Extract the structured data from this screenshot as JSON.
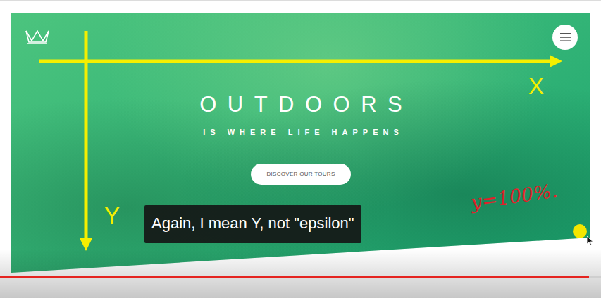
{
  "hero": {
    "title": "OUTDOORS",
    "subtitle": "IS WHERE LIFE HAPPENS",
    "button": "DISCOVER OUR TOURS"
  },
  "annotations": {
    "x_label": "X",
    "y_label": "Y",
    "note": "y=100%."
  },
  "caption": "Again, I mean Y, not \"epsilon\"",
  "player": {
    "progress": 0.98
  }
}
